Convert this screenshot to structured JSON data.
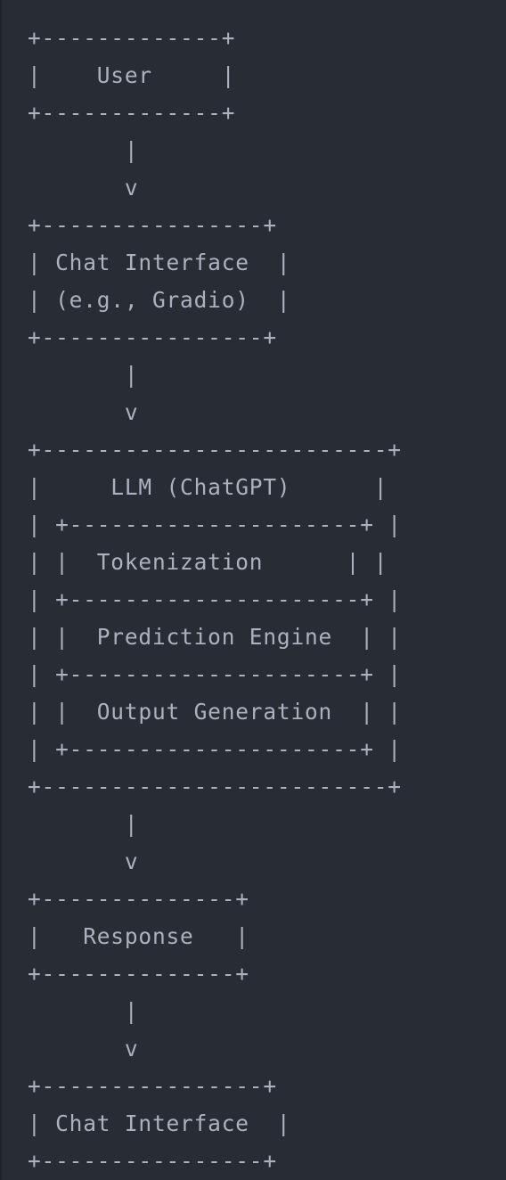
{
  "code_block": {
    "language": "plaintext",
    "lines": [
      "+-------------+",
      "|    User     |",
      "+-------------+",
      "       |",
      "       v",
      "+----------------+",
      "| Chat Interface  |",
      "| (e.g., Gradio)  |",
      "+----------------+",
      "       |",
      "       v",
      "+-------------------------+",
      "|     LLM (ChatGPT)      |",
      "| +---------------------+ |",
      "| |  Tokenization      | |",
      "| +---------------------+ |",
      "| |  Prediction Engine  | |",
      "| +---------------------+ |",
      "| |  Output Generation  | |",
      "| +---------------------+ |",
      "+-------------------------+",
      "       |",
      "       v",
      "+--------------+",
      "|   Response   |",
      "+--------------+",
      "       |",
      "       v",
      "+----------------+",
      "| Chat Interface  |",
      "+----------------+"
    ]
  }
}
